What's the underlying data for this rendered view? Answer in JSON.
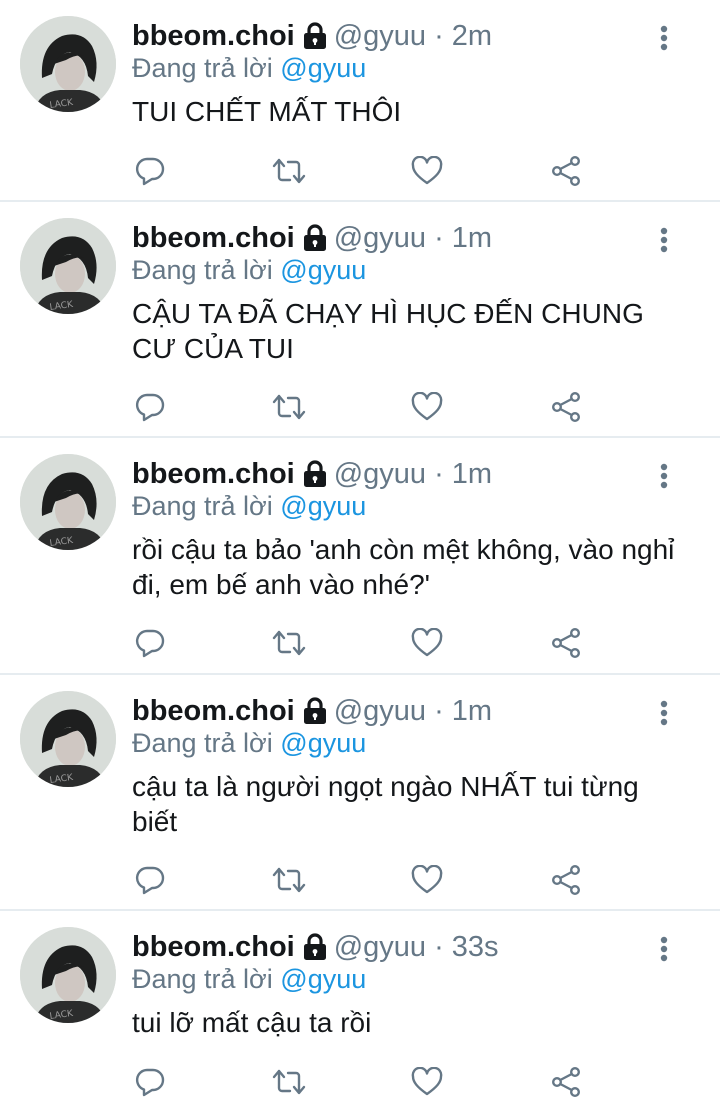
{
  "reply_prefix": "Đang trả lời",
  "tweets": [
    {
      "name": "bbeom.choi",
      "handle": "@gyuu",
      "separator": "·",
      "time": "2m",
      "mention": "@gyuu",
      "text": "TUI CHẾT MẤT THÔI"
    },
    {
      "name": "bbeom.choi",
      "handle": "@gyuu",
      "separator": "·",
      "time": "1m",
      "mention": "@gyuu",
      "text": "CẬU TA ĐÃ CHẠY HÌ HỤC ĐẾN CHUNG CƯ CỦA TUI"
    },
    {
      "name": "bbeom.choi",
      "handle": "@gyuu",
      "separator": "·",
      "time": "1m",
      "mention": "@gyuu",
      "text": "rồi cậu ta bảo 'anh còn mệt không, vào nghỉ đi, em bế anh vào nhé?'"
    },
    {
      "name": "bbeom.choi",
      "handle": "@gyuu",
      "separator": "·",
      "time": "1m",
      "mention": "@gyuu",
      "text": "cậu ta là người ngọt ngào NHẤT tui từng biết"
    },
    {
      "name": "bbeom.choi",
      "handle": "@gyuu",
      "separator": "·",
      "time": "33s",
      "mention": "@gyuu",
      "text": "tui lỡ mất cậu ta rồi"
    }
  ],
  "icons": {
    "lock": "lock-icon",
    "more": "more-vertical-icon",
    "reply": "reply-icon",
    "retweet": "retweet-icon",
    "like": "like-icon",
    "share": "share-icon"
  },
  "colors": {
    "text": "#14171a",
    "secondary": "#657786",
    "link": "#1b95e0",
    "divider": "#e6ecf0"
  }
}
